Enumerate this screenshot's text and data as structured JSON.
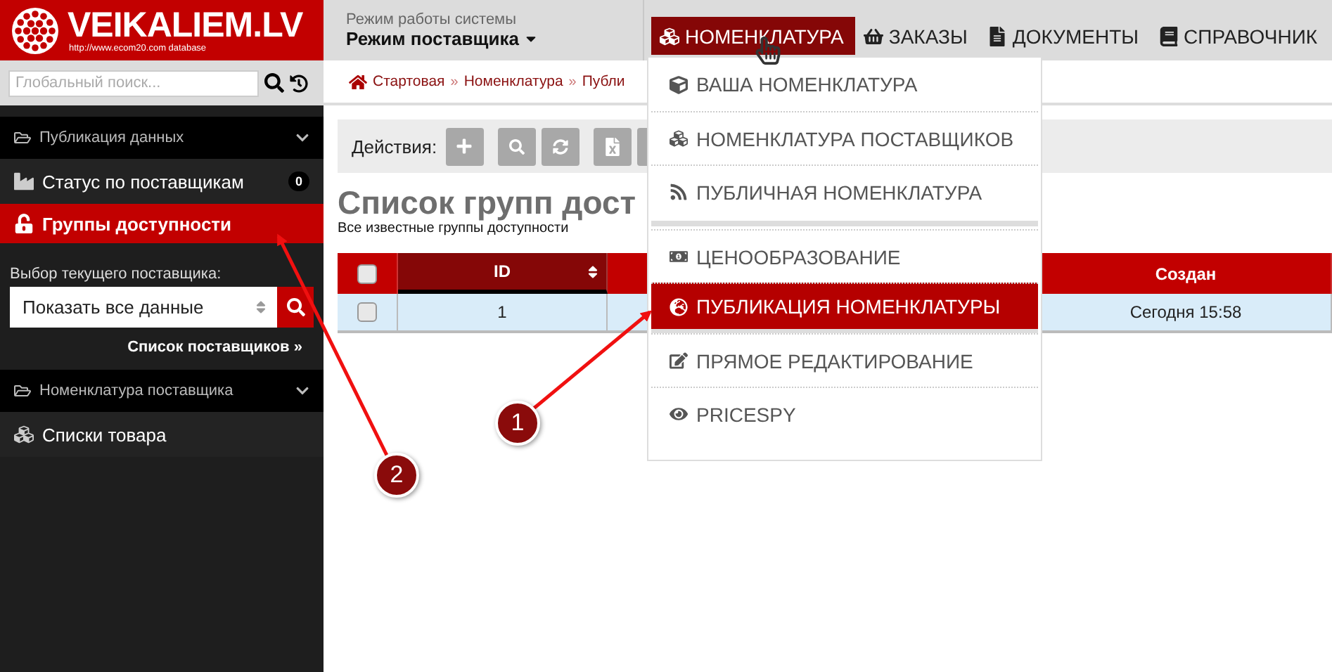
{
  "logo": {
    "title": "VEIKALIEM.LV",
    "subtitle": "http://www.ecom20.com database"
  },
  "mode": {
    "label": "Режим работы системы",
    "value": "Режим поставщика"
  },
  "nav": [
    {
      "label": "НОМЕНКЛАТУРА",
      "selected": true
    },
    {
      "label": "ЗАКАЗЫ",
      "selected": false
    },
    {
      "label": "ДОКУМЕНТЫ",
      "selected": false
    },
    {
      "label": "СПРАВОЧНИК",
      "selected": false
    }
  ],
  "search": {
    "placeholder": "Глобальный поиск..."
  },
  "breadcrumbs": {
    "separator": "»",
    "items": [
      "Стартовая",
      "Номенклатура",
      "Публи"
    ]
  },
  "sidebar": {
    "sections": [
      {
        "title": "Публикация данных",
        "expanded": true,
        "items": [
          {
            "label": "Статус по поставщикам",
            "badge": "0",
            "selected": false
          },
          {
            "label": "Группы доступности",
            "selected": true
          }
        ],
        "picker": {
          "label": "Выбор текущего поставщика:",
          "value": "Показать все данные",
          "link": "Список поставщиков »"
        }
      },
      {
        "title": "Номенклатура поставщика",
        "expanded": true,
        "items": [
          {
            "label": "Списки товара",
            "selected": false
          }
        ]
      }
    ]
  },
  "toolbar": {
    "label": "Действия:"
  },
  "page": {
    "title": "Список групп дост",
    "subtitle": "Все известные группы доступности"
  },
  "table": {
    "all_checked": false,
    "columns": [
      "ID",
      "",
      "Создан"
    ],
    "rows": [
      {
        "checked": false,
        "cells": [
          "1",
          "",
          "Сегодня 15:58"
        ]
      }
    ]
  },
  "dropdown": [
    {
      "kind": "item",
      "label": "ВАША НОМЕНКЛАТУРА",
      "selected": false
    },
    {
      "kind": "item",
      "label": "НОМЕНКЛАТУРА ПОСТАВЩИКОВ",
      "selected": false
    },
    {
      "kind": "item",
      "label": "ПУБЛИЧНАЯ НОМЕНКЛАТУРА",
      "selected": false
    },
    {
      "kind": "divider"
    },
    {
      "kind": "item",
      "label": "ЦЕНООБРАЗОВАНИЕ",
      "selected": false
    },
    {
      "kind": "item",
      "label": "ПУБЛИКАЦИЯ НОМЕНКЛАТУРЫ",
      "selected": true
    },
    {
      "kind": "item",
      "label": "ПРЯМОЕ РЕДАКТИРОВАНИЕ",
      "selected": false
    },
    {
      "kind": "item",
      "label": "PRICESPY",
      "selected": false
    }
  ],
  "annotations": [
    "1",
    "2"
  ]
}
